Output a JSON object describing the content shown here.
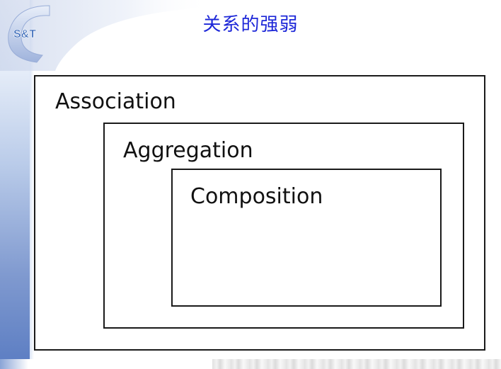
{
  "slide": {
    "title": "关系的强弱",
    "logo_text": "S&T",
    "logo_letter": "C"
  },
  "diagram": {
    "outer_label": "Association",
    "middle_label": "Aggregation",
    "inner_label": "Composition"
  },
  "colors": {
    "title": "#1d27d8",
    "logo_blue": "#2f62b5",
    "logo_orange": "#f0a020",
    "box_border": "#1a1a1a"
  }
}
